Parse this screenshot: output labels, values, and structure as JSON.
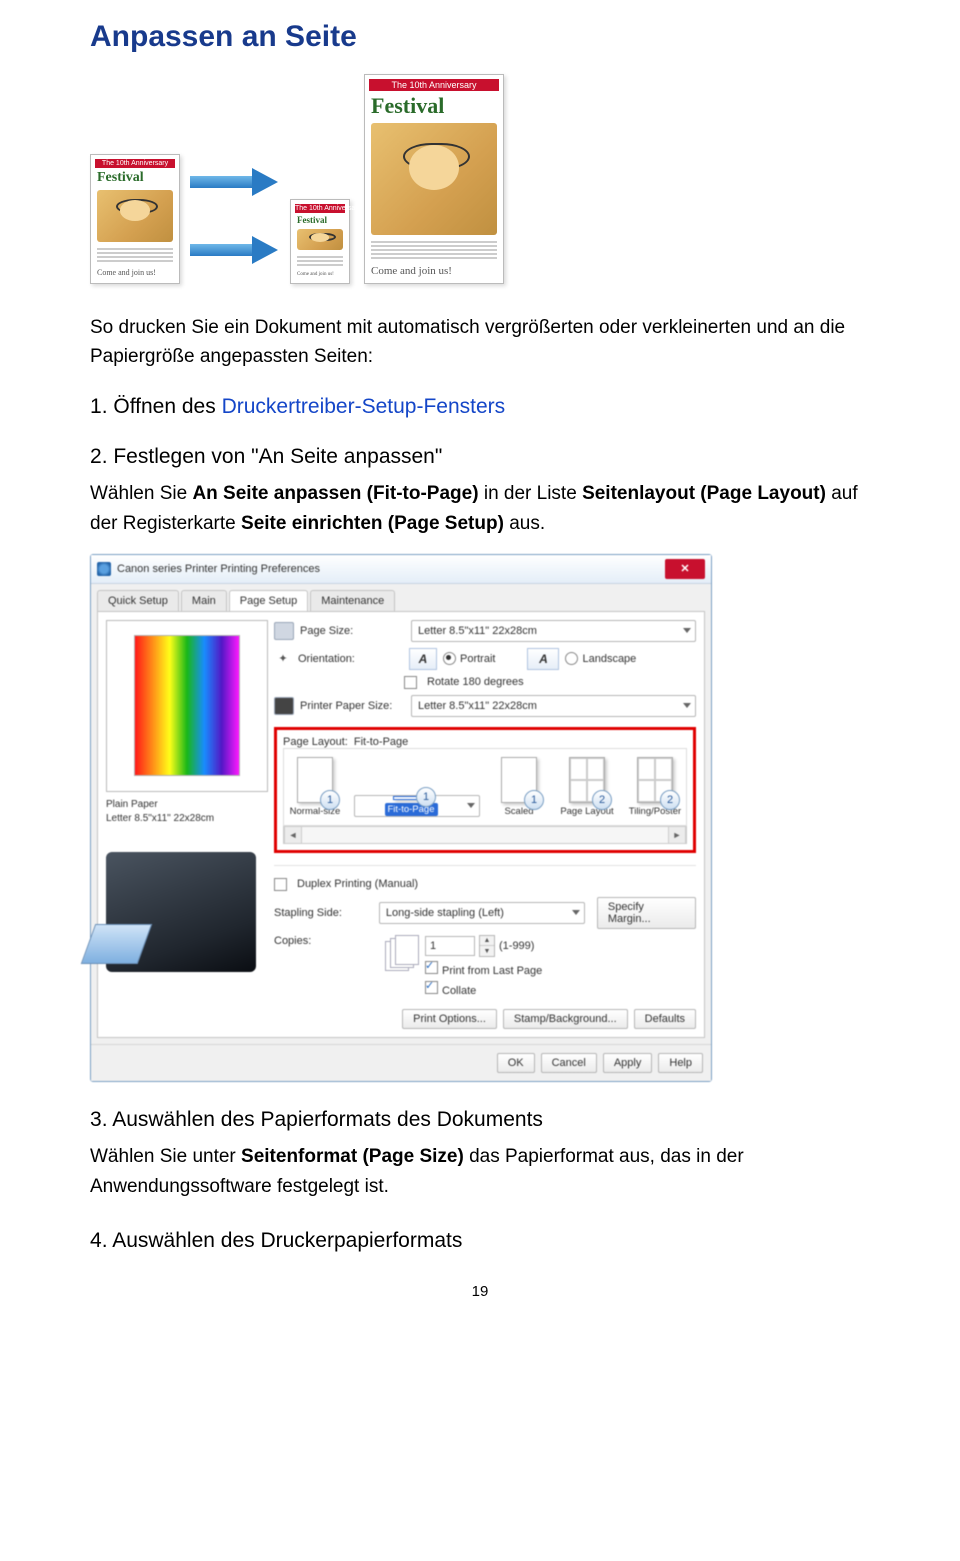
{
  "title": "Anpassen an Seite",
  "illustration": {
    "banner": "The 10th Anniversary",
    "festival": "Festival",
    "come": "Come and join us!"
  },
  "intro": "So drucken Sie ein Dokument mit automatisch vergrößerten oder verkleinerten und an die Papiergröße angepassten Seiten:",
  "steps": {
    "s1": {
      "prefix": "Öffnen des ",
      "link": "Druckertreiber-Setup-Fensters"
    },
    "s2": {
      "head": "Festlegen von \"An Seite anpassen\"",
      "body_1": "Wählen Sie ",
      "b1": "An Seite anpassen (Fit-to-Page)",
      "body_2": " in der Liste ",
      "b2": "Seitenlayout (Page Layout)",
      "body_3": " auf der Registerkarte ",
      "b3": "Seite einrichten (Page Setup)",
      "body_4": " aus."
    },
    "s3": {
      "head": "Auswählen des Papierformats des Dokuments",
      "body_1": "Wählen Sie unter ",
      "b1": "Seitenformat (Page Size)",
      "body_2": " das Papierformat aus, das in der Anwendungssoftware festgelegt ist."
    },
    "s4": {
      "head": "Auswählen des Druckerpapierformats"
    }
  },
  "dialog": {
    "title": "Canon           series Printer Printing Preferences",
    "tabs": [
      "Quick Setup",
      "Main",
      "Page Setup",
      "Maintenance"
    ],
    "page_size_label": "Page Size:",
    "page_size_value": "Letter 8.5\"x11\" 22x28cm",
    "orientation_label": "Orientation:",
    "portrait": "Portrait",
    "landscape": "Landscape",
    "rotate": "Rotate 180 degrees",
    "printer_paper_label": "Printer Paper Size:",
    "printer_paper_value": "Letter 8.5\"x11\" 22x28cm",
    "page_layout_label": "Page Layout:",
    "page_layout_value": "Fit-to-Page",
    "layouts": [
      "Normal-size",
      "Fit-to-Page",
      "Scaled",
      "Page Layout",
      "Tiling/Poster"
    ],
    "duplex": "Duplex Printing (Manual)",
    "stapling_label": "Stapling Side:",
    "stapling_value": "Long-side stapling (Left)",
    "margin_btn": "Specify Margin...",
    "copies_label": "Copies:",
    "copies_value": "1",
    "copies_range": "(1-999)",
    "print_last": "Print from Last Page",
    "collate": "Collate",
    "print_options": "Print Options...",
    "stamp": "Stamp/Background...",
    "defaults": "Defaults",
    "ok": "OK",
    "cancel": "Cancel",
    "apply": "Apply",
    "help": "Help",
    "preview_media": "Plain Paper",
    "preview_size": "Letter 8.5\"x11\" 22x28cm"
  },
  "page_number": "19"
}
